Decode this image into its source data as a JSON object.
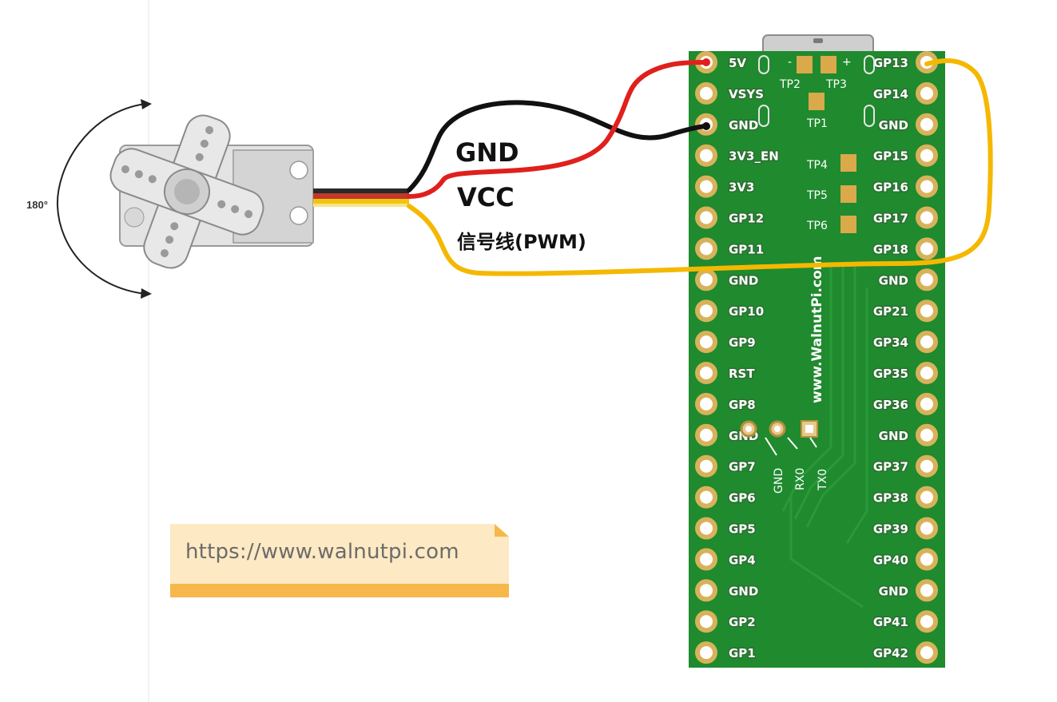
{
  "wiring": {
    "labels": {
      "gnd": "GND",
      "vcc": "VCC",
      "signal": "信号线(PWM)"
    }
  },
  "servo": {
    "angle_label": "180°"
  },
  "url_note": {
    "text": "https://www.walnutpi.com"
  },
  "board": {
    "website": "www.WalnutPi.com",
    "left_pins": [
      "5V",
      "VSYS",
      "GND",
      "3V3_EN",
      "3V3",
      "GP12",
      "GP11",
      "GND",
      "GP10",
      "GP9",
      "RST",
      "GP8",
      "GND",
      "GP7",
      "GP6",
      "GP5",
      "GP4",
      "GND",
      "GP2",
      "GP1"
    ],
    "right_pins": [
      "GP13",
      "GP14",
      "GND",
      "GP15",
      "GP16",
      "GP17",
      "GP18",
      "GND",
      "GP21",
      "GP34",
      "GP35",
      "GP36",
      "GND",
      "GP37",
      "GP38",
      "GP39",
      "GP40",
      "GND",
      "GP41",
      "GP42"
    ],
    "test_points": [
      "TP2",
      "TP3",
      "TP1",
      "TP4",
      "TP5",
      "TP6"
    ],
    "debug_pins": [
      "GND",
      "RX0",
      "TX0"
    ],
    "top_marks": [
      "-",
      "+"
    ]
  },
  "colors": {
    "board_green": "#1f8a2e",
    "gnd_wire": "#111111",
    "vcc_wire": "#e0201c",
    "signal_wire": "#f5b800",
    "note_fill": "#fde9c3",
    "note_bar": "#f6b84a"
  }
}
